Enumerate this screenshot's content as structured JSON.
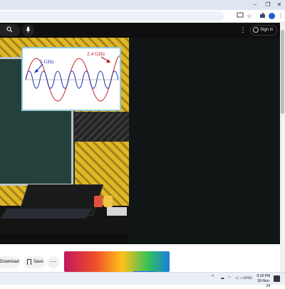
{
  "window": {
    "controls": {
      "minimize": "–",
      "maximize": "❐",
      "close": "✕"
    }
  },
  "toolbar": {
    "icons": [
      "cast-icon",
      "star-icon",
      "extensions-icon",
      "profile-icon",
      "menu-icon"
    ]
  },
  "youtube_header": {
    "sign_in_label": "Sign in",
    "more_label": "⋮"
  },
  "video": {
    "overlay_labels": {
      "left": "5 GHz",
      "right": "2.4 GHz"
    },
    "overlay_colors": {
      "label_5ghz": "#1a2fb0",
      "label_24ghz": "#c0191f",
      "wave_5ghz": "#1a2fb0",
      "wave_24ghz": "#c0191f"
    }
  },
  "actions": {
    "download_label": "Download",
    "save_label": "Save",
    "more_label": "···"
  },
  "taskbar": {
    "language": "ENG",
    "time": "9:18 PM",
    "date": "30-Nov-24"
  },
  "colors": {
    "youtube_header": "#0f0f0f",
    "chrome_frame": "#dfe6f2",
    "taskbar": "#e9eef7"
  }
}
